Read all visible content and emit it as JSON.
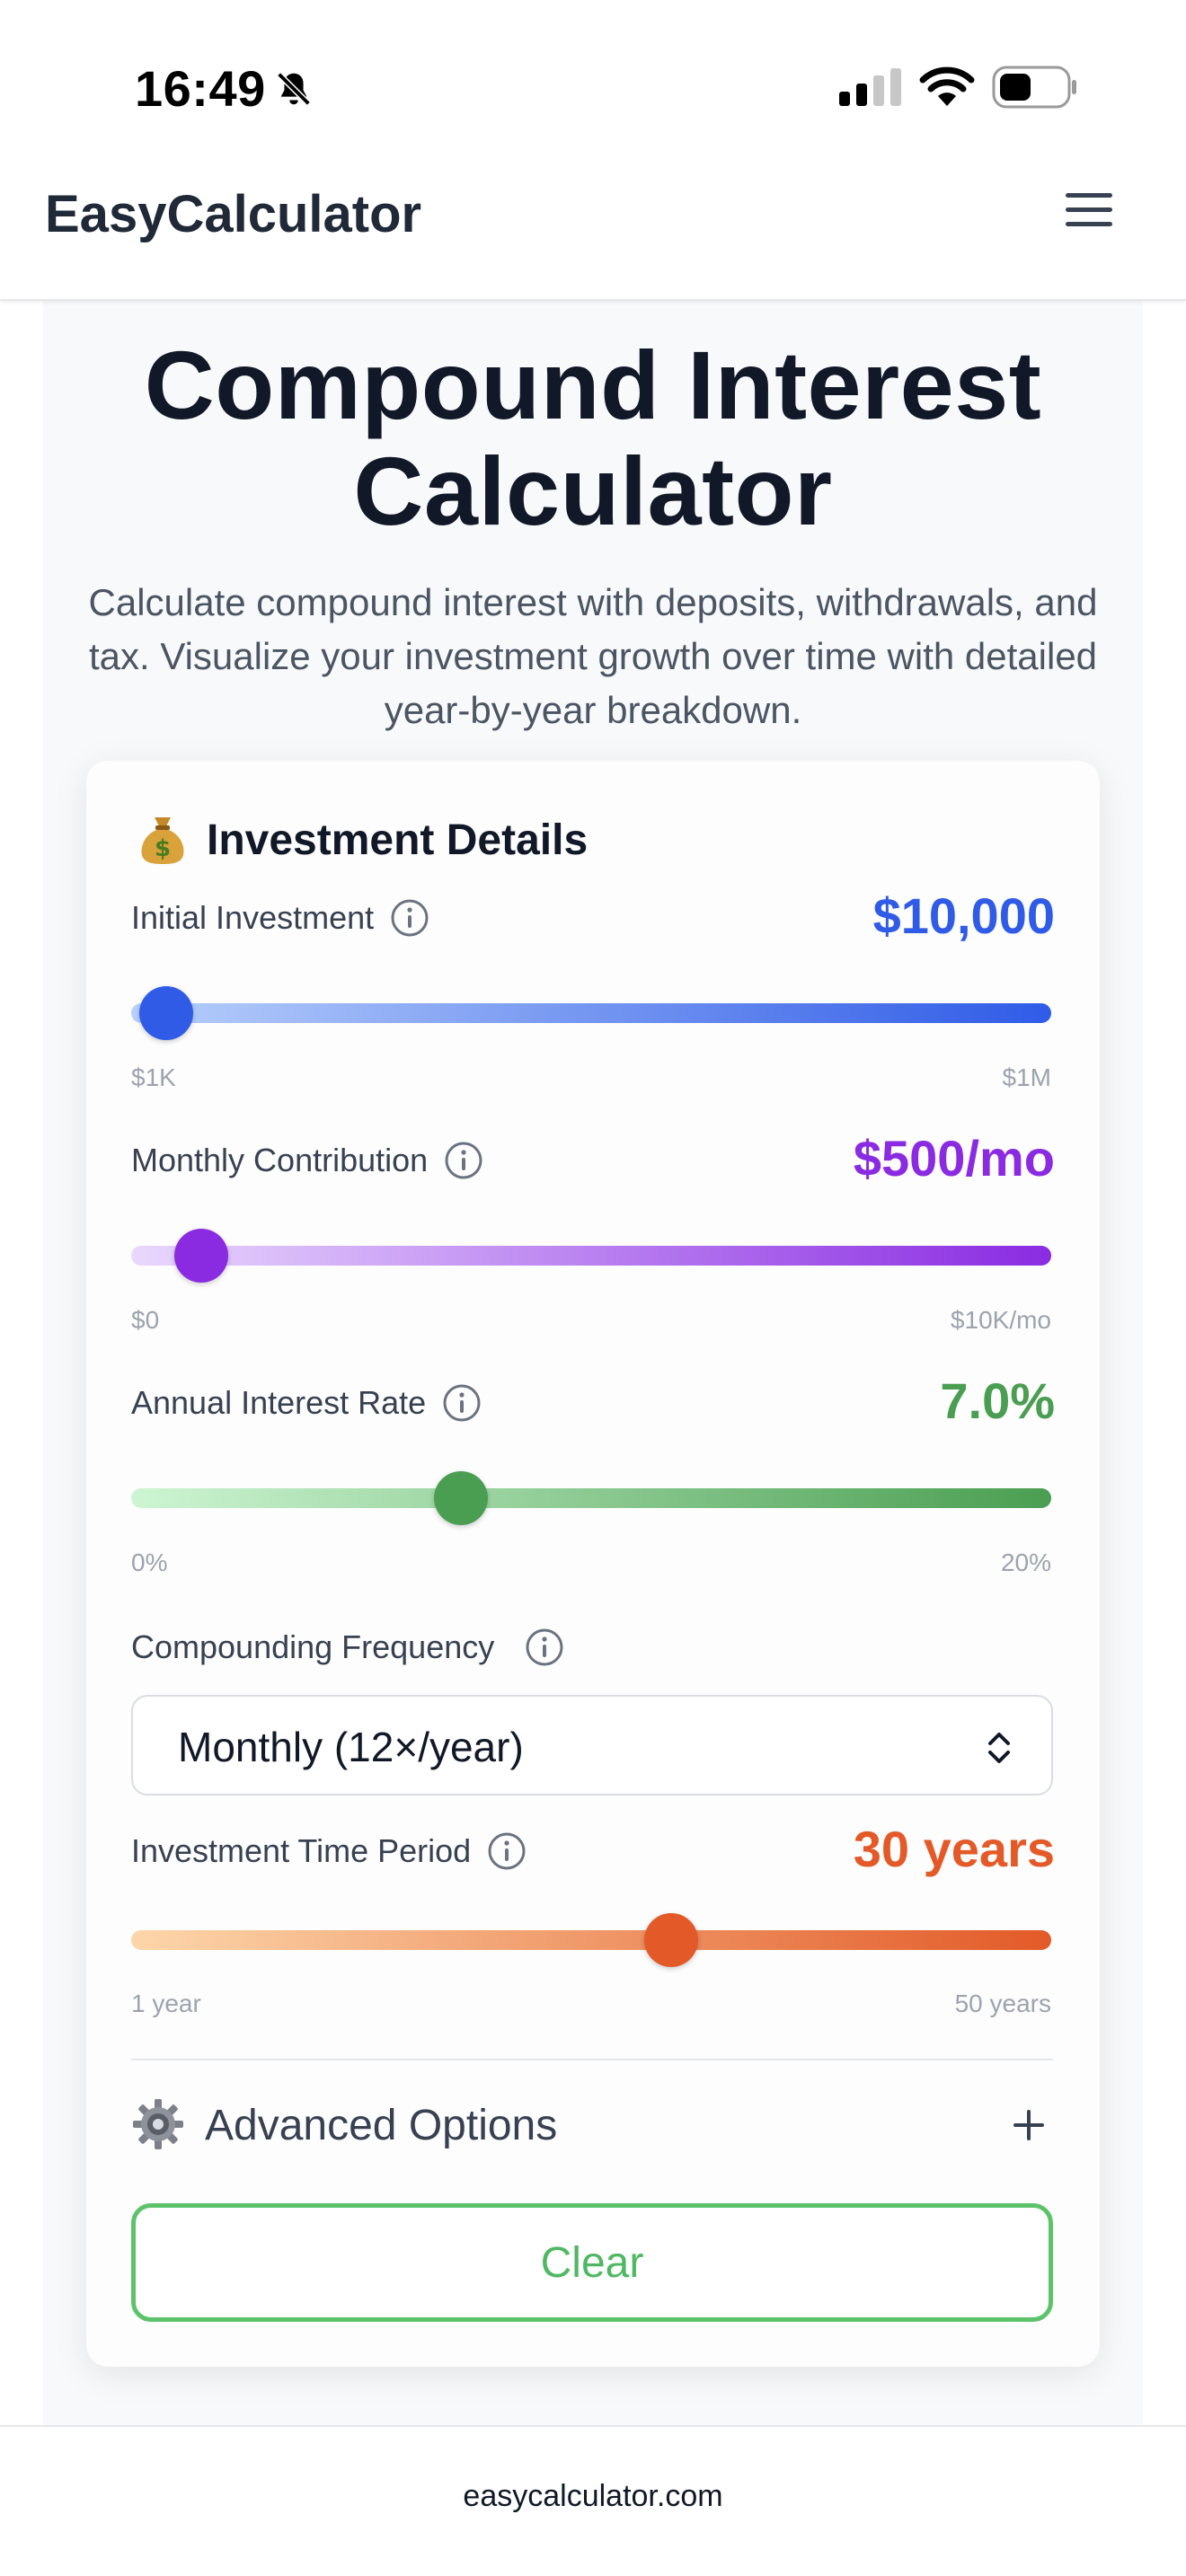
{
  "status_bar": {
    "time": "16:49",
    "icons": [
      "bell-slash-icon",
      "cellular-signal-icon",
      "wifi-icon",
      "battery-icon"
    ]
  },
  "header": {
    "brand": "EasyCalculator",
    "menu_icon": "hamburger-menu-icon"
  },
  "page": {
    "title_line1": "Compound Interest",
    "title_line2": "Calculator",
    "subtitle": "Calculate compound interest with deposits, withdrawals, and tax. Visualize your investment growth over time with detailed year-by-year breakdown."
  },
  "card": {
    "heading": "Investment Details",
    "heading_icon": "money-bag-icon",
    "fields": {
      "initial": {
        "label": "Initial Investment",
        "value": "$10,000",
        "min_label": "$1K",
        "max_label": "$1M",
        "fraction": 0.009,
        "color": "#2f5be7"
      },
      "monthly": {
        "label": "Monthly Contribution",
        "value": "$500/mo",
        "min_label": "$0",
        "max_label": "$10K/mo",
        "fraction": 0.05,
        "color": "#8a2be2"
      },
      "rate": {
        "label": "Annual Interest Rate",
        "value": "7.0%",
        "min_label": "0%",
        "max_label": "20%",
        "fraction": 0.35,
        "color": "#4a9e51"
      },
      "frequency": {
        "label": "Compounding Frequency",
        "selected": "Monthly (12×/year)"
      },
      "period": {
        "label": "Investment Time Period",
        "value": "30 years",
        "min_label": "1 year",
        "max_label": "50 years",
        "fraction": 0.592,
        "color": "#e35a28"
      }
    },
    "advanced": {
      "label": "Advanced Options",
      "icon": "gear-icon",
      "toggle_icon": "plus-icon"
    },
    "clear_label": "Clear"
  },
  "footer": {
    "url": "easycalculator.com"
  }
}
